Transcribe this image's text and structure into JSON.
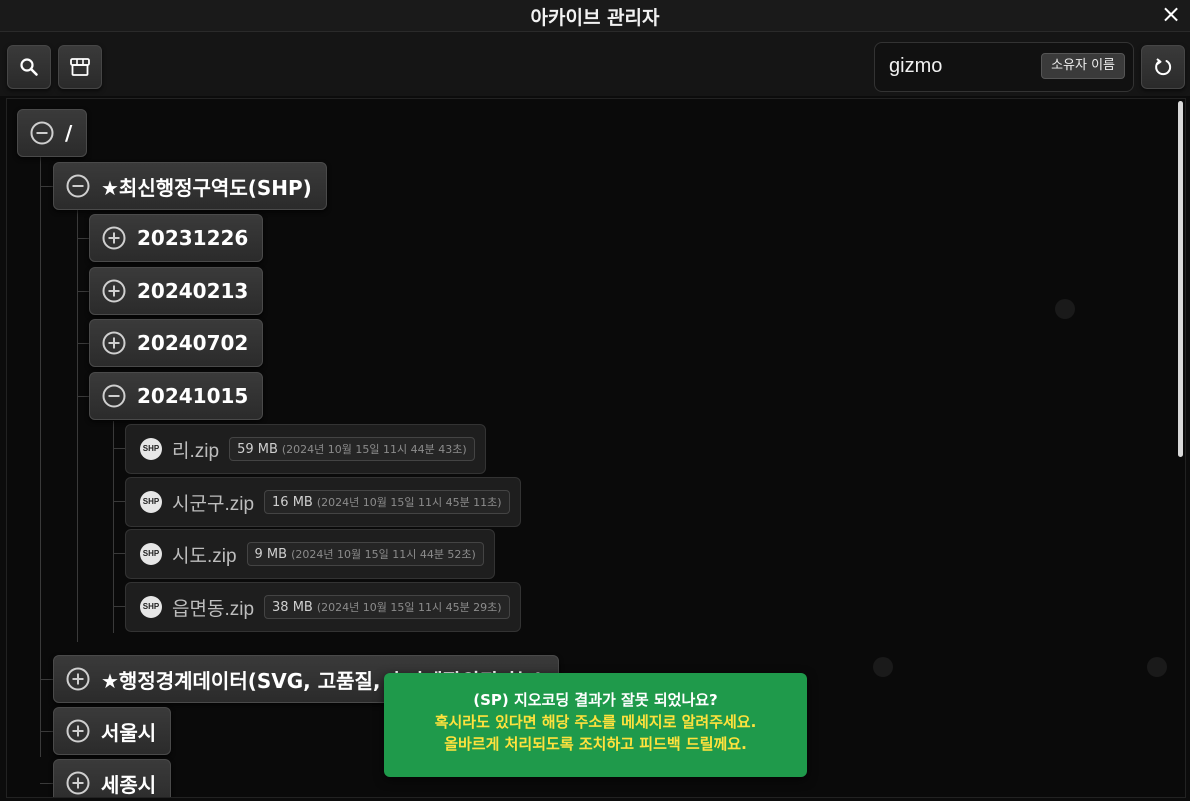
{
  "window": {
    "title": "아카이브 관리자",
    "close_icon": "×"
  },
  "toolbar": {
    "search_icon": "search-icon",
    "store_icon": "store-icon",
    "owner_value": "gizmo",
    "owner_badge": "소유자 이름",
    "refresh_icon": "refresh-icon"
  },
  "tree": {
    "root": {
      "label": "/",
      "state": "expanded"
    },
    "level1": [
      {
        "label": "★최신행정구역도(SHP)",
        "state": "expanded"
      },
      {
        "label": "★행정경계데이터(SVG, 고품질, 추가제작의뢰가능)",
        "state": "collapsed"
      },
      {
        "label": "서울시",
        "state": "collapsed"
      },
      {
        "label": "세종시",
        "state": "collapsed"
      }
    ],
    "dates": [
      {
        "label": "20231226",
        "state": "collapsed"
      },
      {
        "label": "20240213",
        "state": "collapsed"
      },
      {
        "label": "20240702",
        "state": "collapsed"
      },
      {
        "label": "20241015",
        "state": "expanded"
      }
    ],
    "files": [
      {
        "badge": "SHP",
        "name": "리.zip",
        "size": "59 MB",
        "date": "(2024년 10월 15일 11시 44분 43초)"
      },
      {
        "badge": "SHP",
        "name": "시군구.zip",
        "size": "16 MB",
        "date": "(2024년 10월 15일 11시 45분 11초)"
      },
      {
        "badge": "SHP",
        "name": "시도.zip",
        "size": "9 MB",
        "date": "(2024년 10월 15일 11시 44분 52초)"
      },
      {
        "badge": "SHP",
        "name": "읍면동.zip",
        "size": "38 MB",
        "date": "(2024년 10월 15일 11시 45분 29초)"
      }
    ]
  },
  "toast": {
    "line1": "(SP) 지오코딩 결과가 잘못 되었나요?",
    "line2": "혹시라도 있다면 해당 주소를 메세지로 알려주세요.",
    "line3": "올바르게 처리되도록 조치하고 피드백 드릴께요."
  },
  "colors": {
    "toast_bg": "#1f9a4b",
    "toast_highlight": "#ffe23d",
    "background": "#0c0c0c"
  }
}
